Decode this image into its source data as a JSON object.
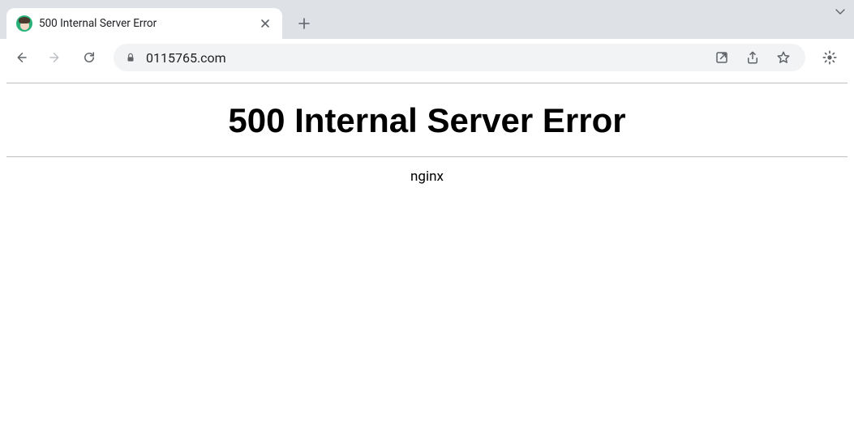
{
  "tab": {
    "title": "500 Internal Server Error"
  },
  "address": {
    "url": "0115765.com"
  },
  "page": {
    "heading": "500 Internal Server Error",
    "server": "nginx"
  }
}
